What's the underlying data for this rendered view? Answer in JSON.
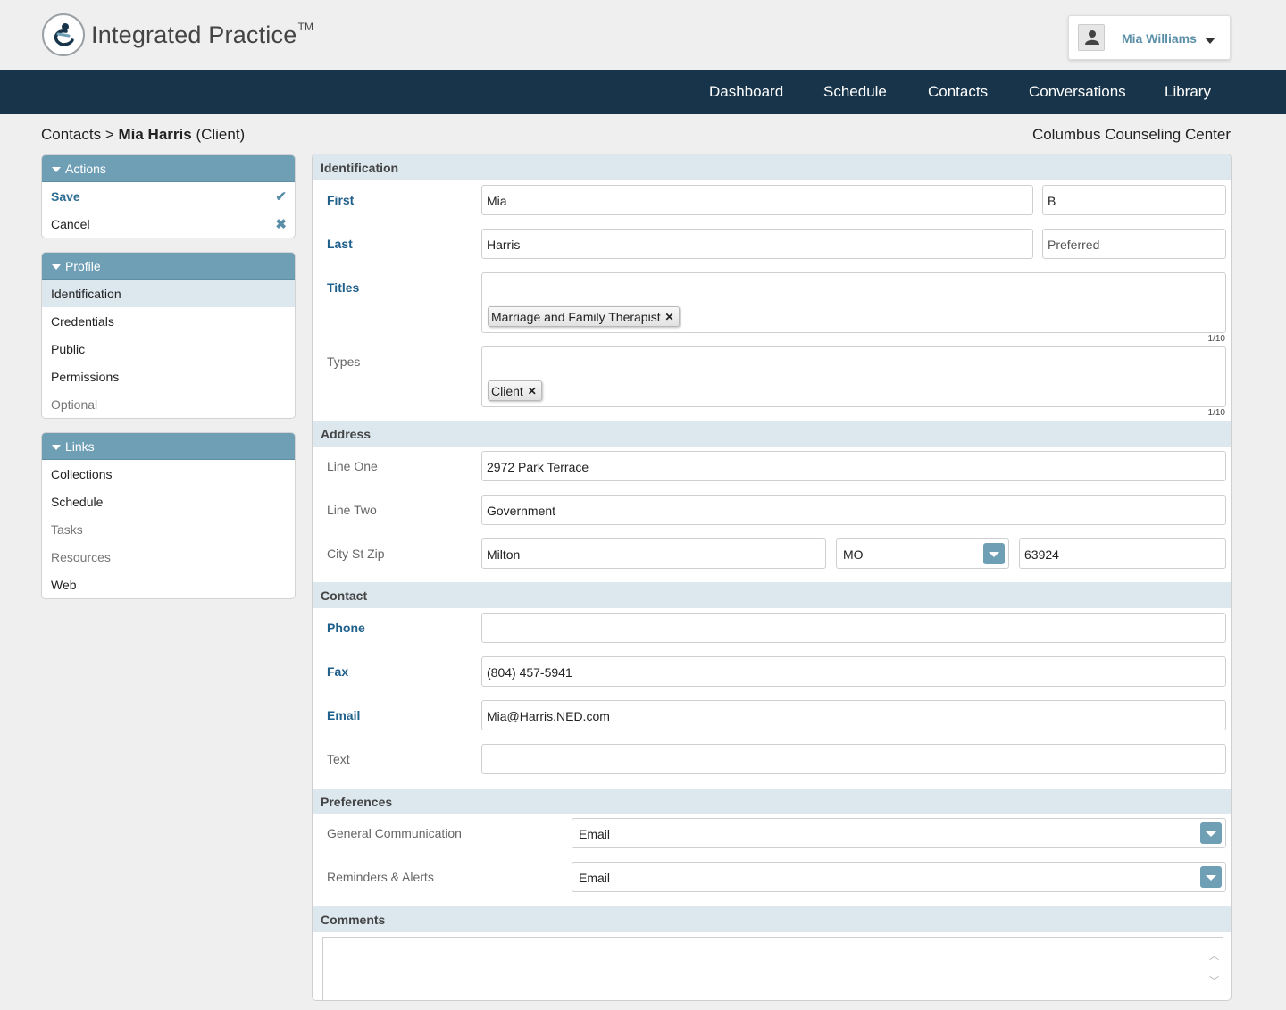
{
  "header": {
    "brand": "Integrated Practice",
    "brand_tm": "TM",
    "user_name": "Mia Williams"
  },
  "nav": {
    "items": [
      "Dashboard",
      "Schedule",
      "Contacts",
      "Conversations",
      "Library"
    ]
  },
  "breadcrumb": {
    "root": "Contacts",
    "separator": ">",
    "name": "Mia Harris",
    "role": "(Client)"
  },
  "organization": "Columbus Counseling Center",
  "sidebar": {
    "actions": {
      "title": "Actions",
      "items": [
        {
          "label": "Save",
          "icon": "check-icon"
        },
        {
          "label": "Cancel",
          "icon": "close-icon"
        }
      ]
    },
    "profile": {
      "title": "Profile",
      "items": [
        "Identification",
        "Credentials",
        "Public",
        "Permissions",
        "Optional"
      ],
      "active": "Identification"
    },
    "links": {
      "title": "Links",
      "items": [
        "Collections",
        "Schedule",
        "Tasks",
        "Resources",
        "Web"
      ]
    }
  },
  "form": {
    "identification": {
      "title": "Identification",
      "first_label": "First",
      "first_value": "Mia",
      "middle_value": "B",
      "last_label": "Last",
      "last_value": "Harris",
      "preferred_placeholder": "Preferred",
      "titles_label": "Titles",
      "titles_tags": [
        "Marriage and Family Therapist"
      ],
      "titles_counter": "1/10",
      "types_label": "Types",
      "types_tags": [
        "Client"
      ],
      "types_counter": "1/10"
    },
    "address": {
      "title": "Address",
      "line_one_label": "Line One",
      "line_one_value": "2972 Park Terrace",
      "line_two_label": "Line Two",
      "line_two_value": "Government",
      "csz_label": "City St Zip",
      "city": "Milton",
      "state": "MO",
      "zip": "63924"
    },
    "contact": {
      "title": "Contact",
      "phone_label": "Phone",
      "phone_value": "",
      "fax_label": "Fax",
      "fax_value": "(804) 457-5941",
      "email_label": "Email",
      "email_value": "Mia@Harris.NED.com",
      "text_label": "Text",
      "text_value": ""
    },
    "preferences": {
      "title": "Preferences",
      "general_label": "General Communication",
      "general_value": "Email",
      "reminders_label": "Reminders & Alerts",
      "reminders_value": "Email"
    },
    "comments": {
      "title": "Comments",
      "value": ""
    }
  },
  "colors": {
    "navbar": "#17344a",
    "panel_header": "#6f9fb5",
    "section_header": "#dce7ee",
    "required_label": "#1f5f8b"
  }
}
